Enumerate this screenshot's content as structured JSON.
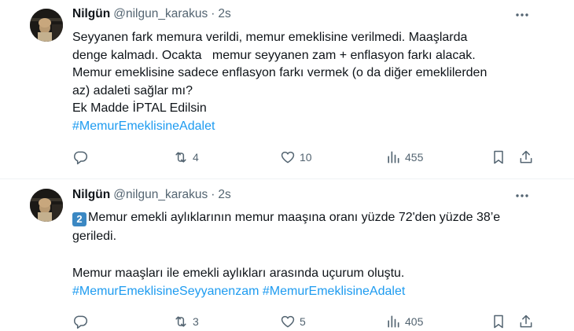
{
  "tweets": [
    {
      "name": "Nilgün",
      "handle": "@nilgun_karakus",
      "separator": "·",
      "time": "2s",
      "lines": [
        "Seyyanen fark memura verildi, memur emeklisine verilmedi. Maaşlarda",
        "denge kalmadı. Ocakta   memur seyyanen zam + enflasyon farkı alacak.",
        "Memur emeklisine sadece enflasyon farkı vermek (o da diğer emeklilerden",
        "az) adaleti sağlar mı?",
        "Ek Madde İPTAL Edilsin"
      ],
      "hashtags": "#MemurEmeklisineAdalet",
      "actions": {
        "replies": "",
        "retweets": "4",
        "likes": "10",
        "views": "455"
      }
    },
    {
      "name": "Nilgün",
      "handle": "@nilgun_karakus",
      "separator": "·",
      "time": "2s",
      "badge": "2",
      "line1": "Memur emekli aylıklarının memur maaşına oranı yüzde 72'den yüzde 38’e",
      "line2": "geriledi.",
      "line3": "Memur maaşları ile emekli aylıkları arasında uçurum oluştu.",
      "hashtags": "#MemurEmeklisineSeyyanenzam #MemurEmeklisineAdalet",
      "actions": {
        "replies": "",
        "retweets": "3",
        "likes": "5",
        "views": "405"
      }
    }
  ],
  "colors": {
    "link": "#1d9bf0",
    "muted": "#536471",
    "text": "#0f1419",
    "badge": "#3b88c3"
  },
  "icons": [
    "more-icon",
    "reply-icon",
    "retweet-icon",
    "like-icon",
    "views-icon",
    "bookmark-icon",
    "share-icon"
  ]
}
